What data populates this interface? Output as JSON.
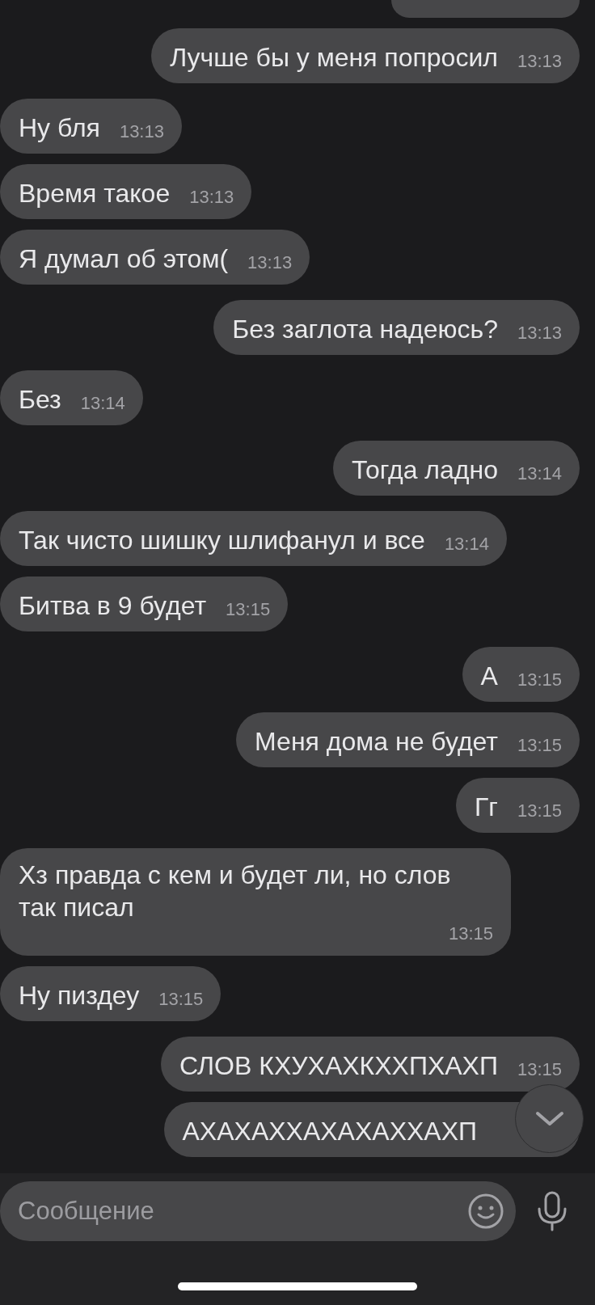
{
  "messages": [
    {
      "kind": "cut",
      "outgoing": true
    },
    {
      "kind": "text",
      "outgoing": true,
      "text": "Лучше бы у меня попросил",
      "time": "13:13"
    },
    {
      "kind": "text",
      "outgoing": false,
      "text": "Ну бля",
      "time": "13:13"
    },
    {
      "kind": "text",
      "outgoing": false,
      "text": "Время такое",
      "time": "13:13"
    },
    {
      "kind": "text",
      "outgoing": false,
      "text": "Я думал об этом(",
      "time": "13:13"
    },
    {
      "kind": "text",
      "outgoing": true,
      "text": "Без заглота надеюсь?",
      "time": "13:13"
    },
    {
      "kind": "text",
      "outgoing": false,
      "text": "Без",
      "time": "13:14"
    },
    {
      "kind": "text",
      "outgoing": true,
      "text": "Тогда ладно",
      "time": "13:14"
    },
    {
      "kind": "text",
      "outgoing": false,
      "text": "Так чисто шишку шлифанул и все",
      "time": "13:14"
    },
    {
      "kind": "text",
      "outgoing": false,
      "text": "Битва в 9 будет",
      "time": "13:15"
    },
    {
      "kind": "text",
      "outgoing": true,
      "text": "А",
      "time": "13:15"
    },
    {
      "kind": "text",
      "outgoing": true,
      "text": "Меня дома не будет",
      "time": "13:15"
    },
    {
      "kind": "text",
      "outgoing": true,
      "text": "Гг",
      "time": "13:15"
    },
    {
      "kind": "text",
      "outgoing": false,
      "text": "Хз правда с кем и будет ли, но слов так писал",
      "time": "13:15"
    },
    {
      "kind": "text",
      "outgoing": false,
      "text": "Ну пиздеу",
      "time": "13:15"
    },
    {
      "kind": "text",
      "outgoing": true,
      "text": "СЛОВ КХУХАХКХХПХАХП",
      "time": "13:15"
    },
    {
      "kind": "text",
      "outgoing": true,
      "text": "АХАХАХХАХАХАХХАХП"
    }
  ],
  "composer": {
    "placeholder": "Сообщение"
  }
}
